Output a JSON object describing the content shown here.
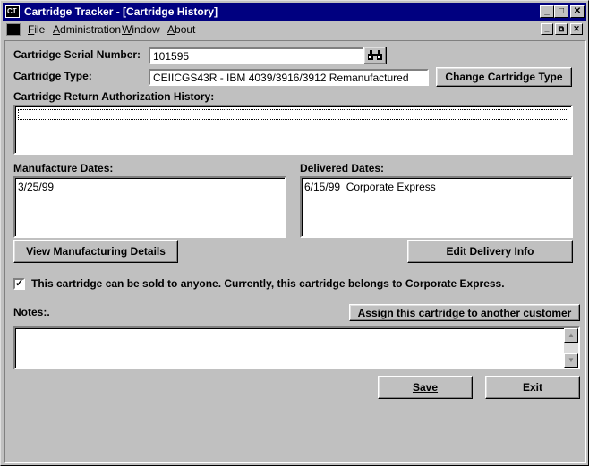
{
  "window": {
    "title": "Cartridge Tracker - [Cartridge History]",
    "app_icon_text": "CT"
  },
  "menu": {
    "items": [
      "File",
      "Administration",
      "Window",
      "About"
    ],
    "underline": [
      "F",
      "A",
      "W",
      "A"
    ]
  },
  "form": {
    "serial_label": "Cartridge Serial Number:",
    "serial_value": "101595",
    "type_label": "Cartridge Type:",
    "type_value": "CEIICGS43R - IBM 4039/3916/3912 Remanufactured",
    "change_type_button": "Change Cartridge Type",
    "rma_label": "Cartridge Return Authorization History:",
    "rma_items": [
      ""
    ],
    "manufacture_label": "Manufacture Dates:",
    "manufacture_items": [
      "3/25/99"
    ],
    "delivered_label": "Delivered Dates:",
    "delivered_items": [
      "6/15/99  Corporate Express"
    ],
    "view_mfg_button": "View Manufacturing Details",
    "edit_delivery_button": "Edit Delivery Info",
    "sold_checkbox_checked": true,
    "sold_checkbox_label": "This cartridge can be sold to anyone.  Currently, this cartridge belongs to Corporate Express.",
    "notes_label": "Notes:.",
    "notes_value": "",
    "assign_button": "Assign this cartridge to another customer",
    "save_button": "Save",
    "exit_button": "Exit"
  },
  "icons": {
    "binoculars": "binoculars-icon",
    "minimize": "minimize-icon",
    "maximize": "maximize-icon",
    "close": "close-icon",
    "restore": "restore-icon"
  }
}
